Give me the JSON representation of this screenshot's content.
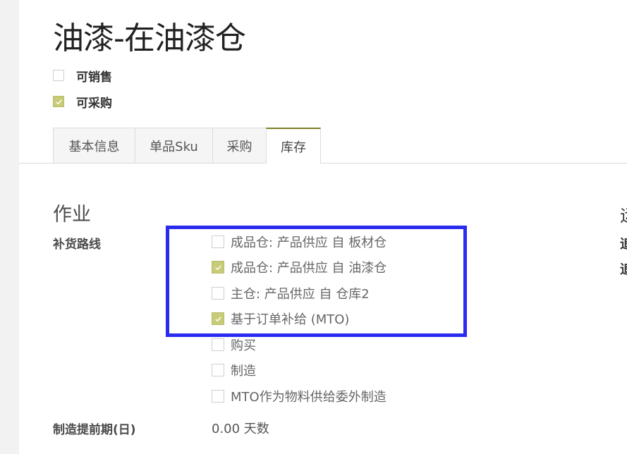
{
  "title": "油漆-在油漆仓",
  "flags": [
    {
      "label": "可销售",
      "checked": false
    },
    {
      "label": "可采购",
      "checked": true
    }
  ],
  "tabs": [
    {
      "label": "基本信息",
      "active": false
    },
    {
      "label": "单品Sku",
      "active": false
    },
    {
      "label": "采购",
      "active": false
    },
    {
      "label": "库存",
      "active": true
    }
  ],
  "operations": {
    "section_title": "作业",
    "routes_label": "补货路线",
    "routes": [
      {
        "label": "成品仓: 产品供应 自 板材仓",
        "checked": false
      },
      {
        "label": "成品仓: 产品供应 自 油漆仓",
        "checked": true
      },
      {
        "label": "主仓: 产品供应 自 仓库2",
        "checked": false
      },
      {
        "label": "基于订单补给 (MTO)",
        "checked": true
      },
      {
        "label": "购买",
        "checked": false
      },
      {
        "label": "制造",
        "checked": false
      },
      {
        "label": "MTO作为物料供给委外制造",
        "checked": false
      }
    ],
    "lead_time_label": "制造提前期(日)",
    "lead_time_value": "0.00 天数"
  },
  "right_clipped": {
    "section_title_fragment": "运",
    "label_1_fragment": "追",
    "label_2_fragment": "追"
  },
  "colors": {
    "accent": "#7c7d28",
    "checkbox_checked": "#c8cc78",
    "highlight_border": "#2b2bf0"
  }
}
